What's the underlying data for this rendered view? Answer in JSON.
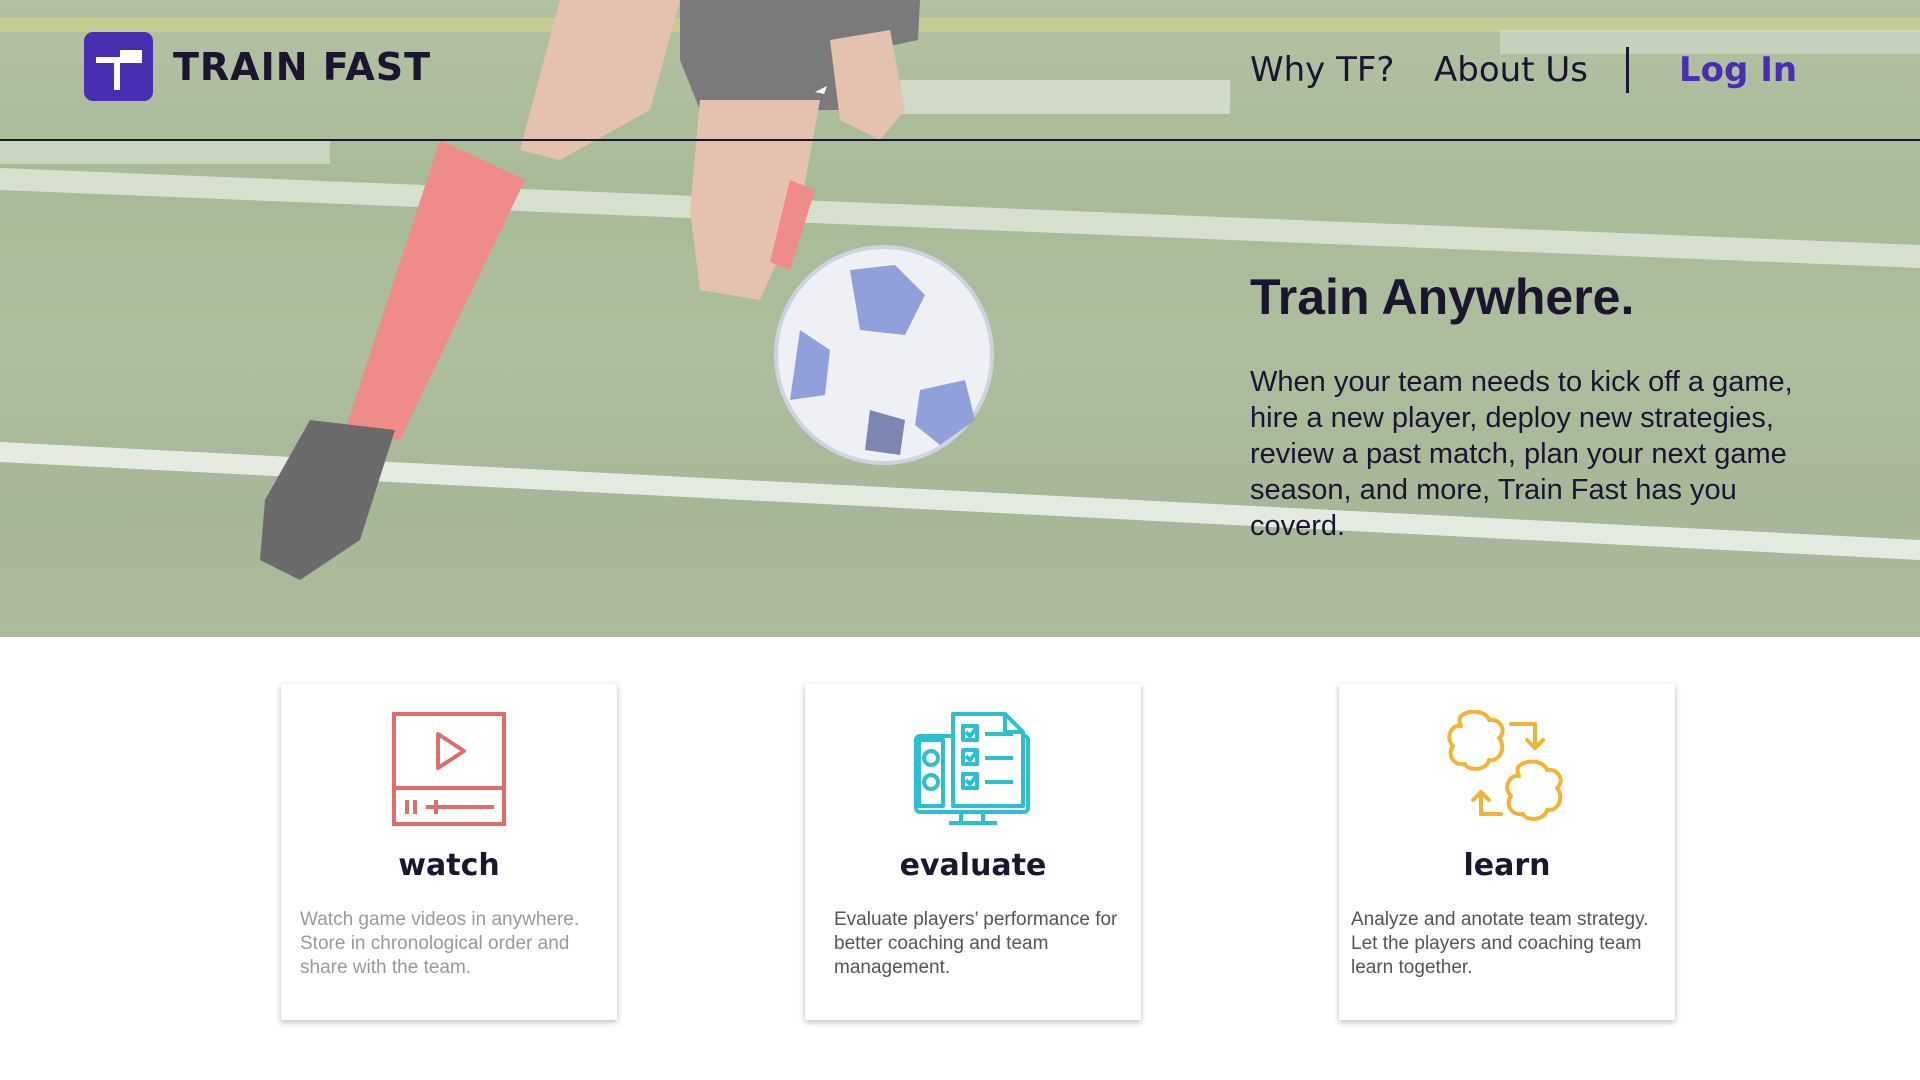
{
  "brand": {
    "name": "TRAIN FAST",
    "accent": "#4a2eb2",
    "text_color": "#1b1530"
  },
  "nav": {
    "why": "Why TF?",
    "about": "About Us",
    "login": "Log In"
  },
  "hero": {
    "title": "Train Anywhere.",
    "body": "When your team needs to kick off a game, hire a new player, deploy new strategies, review a past match,  plan your next game season, and more, Train Fast has you coverd."
  },
  "features": [
    {
      "icon": "video-player-icon",
      "icon_color": "#e06c6c",
      "title": "watch",
      "description": "Watch game videos in anywhere. Store in chronological order and share  with the team."
    },
    {
      "icon": "evaluation-checklist-icon",
      "icon_color": "#2bbfd1",
      "title": "evaluate",
      "description": "Evaluate players’ performance for better coaching and team management."
    },
    {
      "icon": "brain-exchange-icon",
      "icon_color": "#f5b335",
      "title": "learn",
      "description": "Analyze and anotate team strategy. Let the players and coaching team learn together."
    }
  ]
}
